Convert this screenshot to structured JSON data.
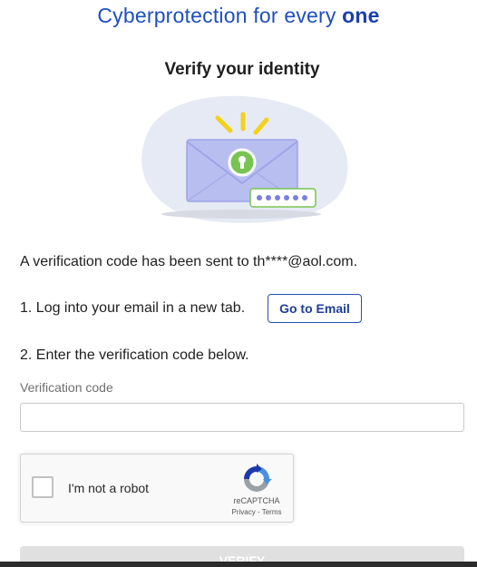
{
  "header": {
    "tagline_prefix": "Cyberprotection for every ",
    "tagline_bold": "one"
  },
  "main": {
    "title": "Verify your identity",
    "sent_message": "A verification code has been sent to th****@aol.com.",
    "step1_text": "1. Log into your email in a new tab.",
    "go_to_email_label": "Go to Email",
    "step2_text": "2. Enter the verification code below.",
    "code_label": "Verification code",
    "code_value": "",
    "verify_label": "VERIFY"
  },
  "recaptcha": {
    "label": "I'm not a robot",
    "brand": "reCAPTCHA",
    "privacy": "Privacy",
    "separator": " - ",
    "terms": "Terms",
    "checked": false
  },
  "illustration": {
    "icon": "envelope-lock-icon",
    "blob_color": "#e6eaf4",
    "envelope_color": "#b9bef0",
    "lock_color": "#78c452",
    "spark_color": "#f2d21c",
    "dots_color": "#7a7fe0"
  },
  "colors": {
    "brand_blue": "#1f4fbf",
    "button_border": "#2a4fa8",
    "disabled_button": "#e0e0e0"
  }
}
